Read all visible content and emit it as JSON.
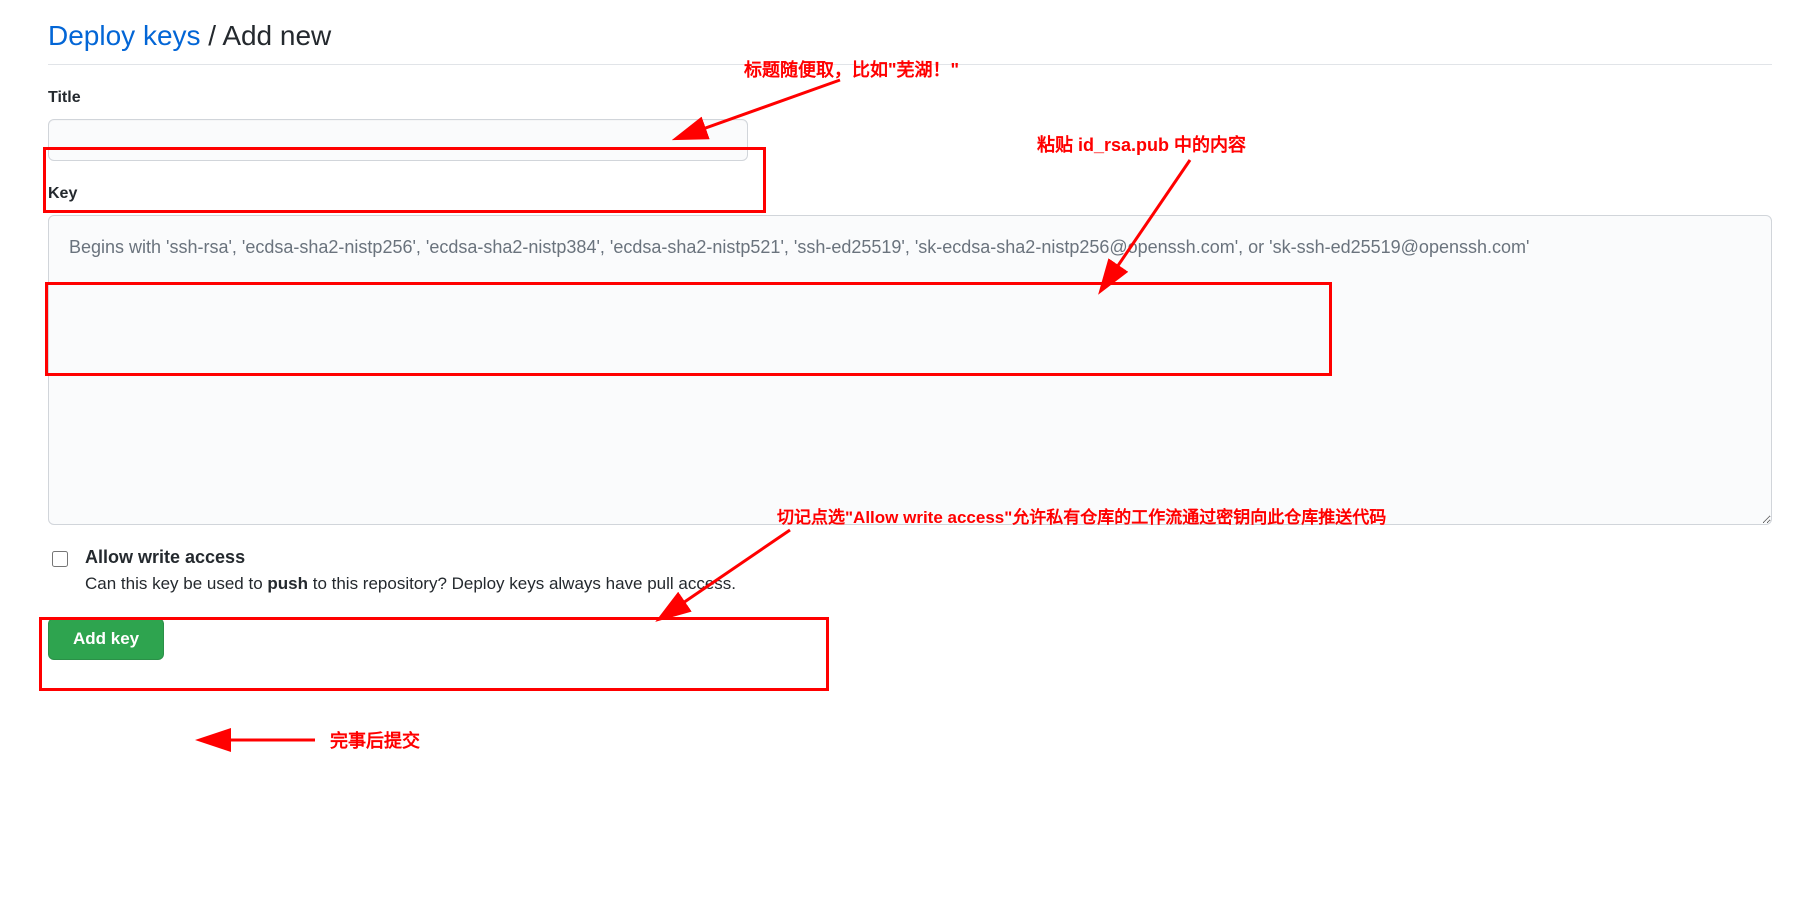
{
  "heading": {
    "link_text": "Deploy keys",
    "separator": " / ",
    "current": "Add new"
  },
  "form": {
    "title_label": "Title",
    "title_value": "",
    "key_label": "Key",
    "key_value": "",
    "key_placeholder": "Begins with 'ssh-rsa', 'ecdsa-sha2-nistp256', 'ecdsa-sha2-nistp384', 'ecdsa-sha2-nistp521', 'ssh-ed25519', 'sk-ecdsa-sha2-nistp256@openssh.com', or 'sk-ssh-ed25519@openssh.com'",
    "allow_write_label": "Allow write access",
    "allow_write_desc_before": "Can this key be used to ",
    "allow_write_desc_bold": "push",
    "allow_write_desc_after": " to this repository? Deploy keys always have pull access.",
    "submit_label": "Add key"
  },
  "annotations": {
    "title_note": "标题随便取，比如\"芜湖！\"",
    "key_note": "粘贴 id_rsa.pub 中的内容",
    "write_note": "切记点选\"Allow write access\"允许私有仓库的工作流通过密钥向此仓库推送代码",
    "submit_note": "完事后提交"
  }
}
